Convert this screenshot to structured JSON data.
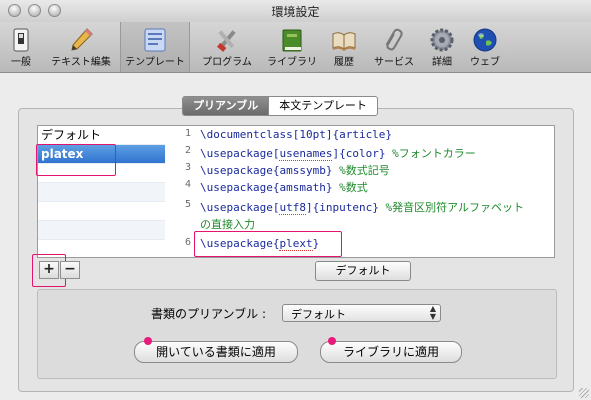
{
  "window": {
    "title": "環境設定"
  },
  "toolbar": {
    "items": [
      {
        "label": "一般",
        "icon": "switch-icon"
      },
      {
        "label": "テキスト編集",
        "icon": "pencil-icon"
      },
      {
        "label": "テンプレート",
        "icon": "template-icon",
        "selected": true
      },
      {
        "label": "プログラム",
        "icon": "tools-icon"
      },
      {
        "label": "ライブラリ",
        "icon": "book-icon"
      },
      {
        "label": "履歴",
        "icon": "open-book-icon"
      },
      {
        "label": "サービス",
        "icon": "paperclip-icon"
      },
      {
        "label": "詳細",
        "icon": "gear-icon"
      },
      {
        "label": "ウェブ",
        "icon": "globe-icon"
      }
    ]
  },
  "tabs": {
    "preamble": "プリアンブル",
    "body": "本文テンプレート"
  },
  "list": {
    "items": [
      "デフォルト",
      "platex"
    ],
    "selected": "platex"
  },
  "editor": {
    "lines": [
      {
        "num": "1",
        "code": "\\documentclass[10pt]{article}",
        "comment": ""
      },
      {
        "num": "2",
        "code": "\\usepackage[usenames]{color} ",
        "comment": "%フォントカラー"
      },
      {
        "num": "3",
        "code": "\\usepackage{amssymb} ",
        "comment": "%数式記号"
      },
      {
        "num": "4",
        "code": "\\usepackage{amsmath} ",
        "comment": "%数式"
      },
      {
        "num": "5",
        "code": "\\usepackage[utf8]{inputenc} ",
        "comment": "%発音区別符アルファベット"
      },
      {
        "num": "",
        "code": "",
        "comment": "の直接入力"
      },
      {
        "num": "6",
        "code": "\\usepackage{plext}",
        "comment": ""
      }
    ]
  },
  "buttons": {
    "add": "+",
    "remove": "−",
    "default": "デフォルト",
    "apply_open": "開いている書類に適用",
    "apply_library": "ライブラリに適用"
  },
  "preamble_select": {
    "label": "書類のプリアンブル :",
    "value": "デフォルト"
  },
  "colors": {
    "highlight": "#e2156e",
    "selection": "#3a7fd6",
    "comment": "#1e8a2c",
    "code": "#1a2a9a"
  }
}
